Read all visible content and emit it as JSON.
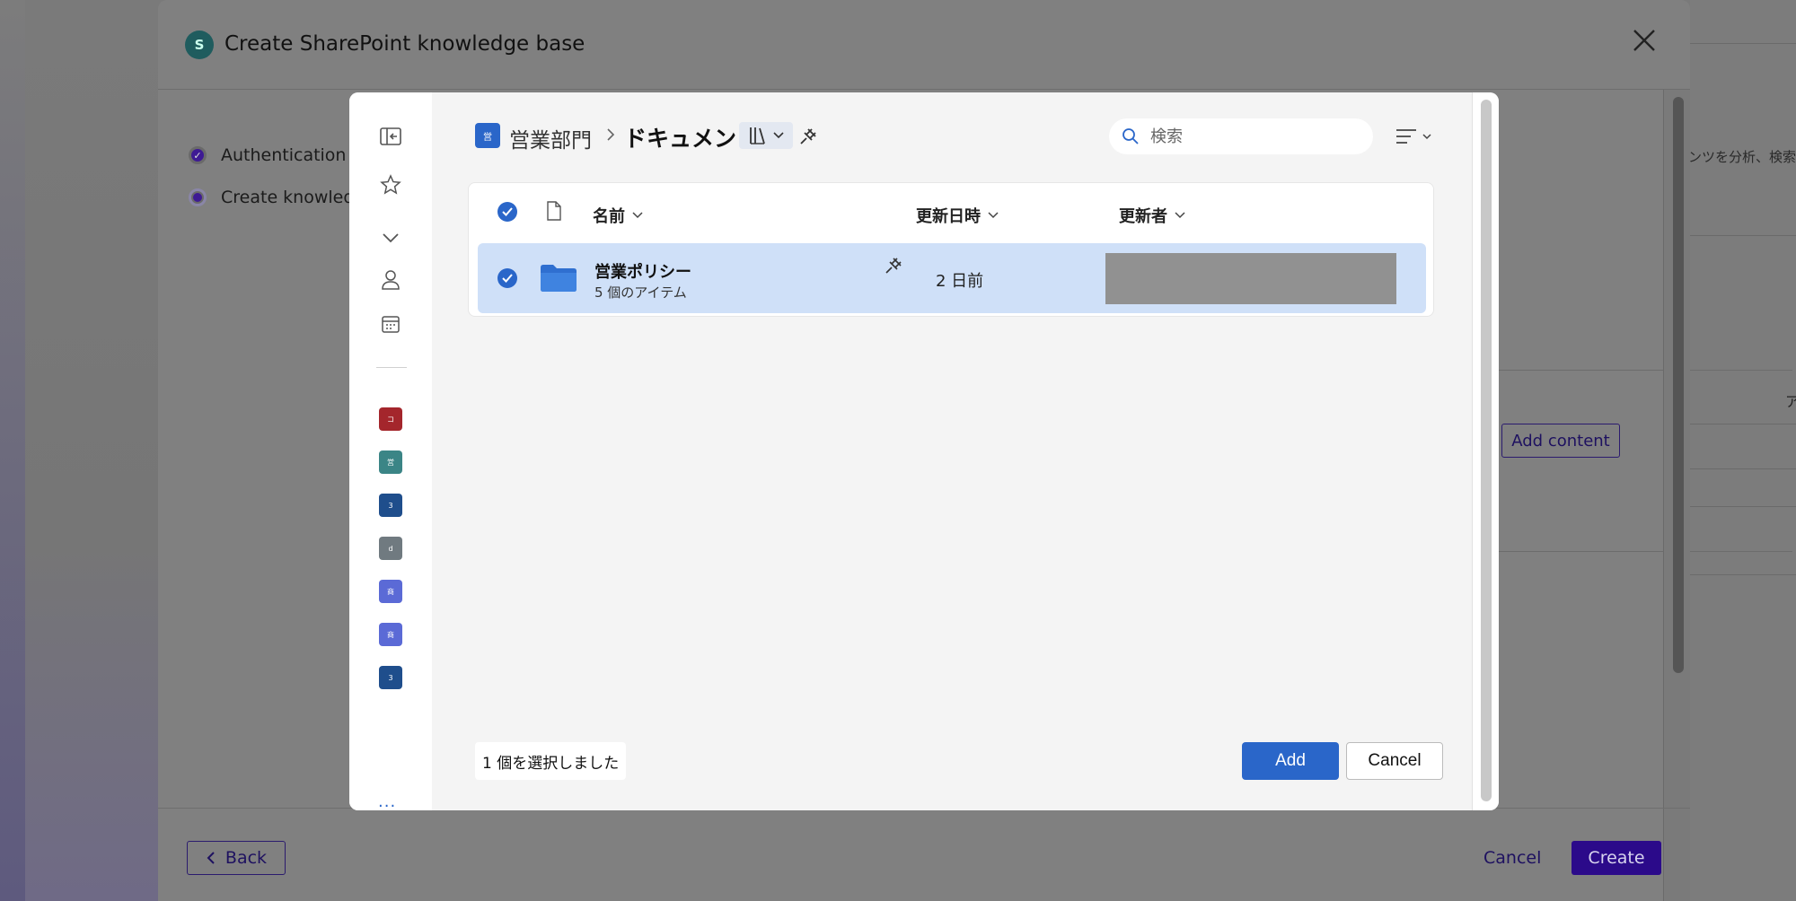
{
  "outer": {
    "title": "Create SharePoint knowledge base",
    "logo_letter": "S",
    "steps": [
      "Authentication m",
      "Create knowledge"
    ],
    "back_label": "Back",
    "cancel_label": "Cancel",
    "create_label": "Create",
    "add_content_label": "Add content",
    "right_text": "ンツを分析、検索",
    "right_col_letter": "ア"
  },
  "picker": {
    "breadcrumb": {
      "site_icon_text": "営",
      "site": "営業部門",
      "current": "ドキュメント"
    },
    "search": {
      "placeholder": "検索"
    },
    "columns": {
      "name": "名前",
      "modified": "更新日時",
      "modified_by": "更新者"
    },
    "rows": [
      {
        "name": "営業ポリシー",
        "sub": "5 個のアイテム",
        "modified": "2 日前",
        "modified_by": ""
      }
    ],
    "rail_sites": [
      {
        "letter": "コ",
        "color": "#a4262c"
      },
      {
        "letter": "営",
        "color": "#3b8586"
      },
      {
        "letter": "3",
        "color": "#1f4e8c"
      },
      {
        "letter": "d",
        "color": "#707a80"
      },
      {
        "letter": "商",
        "color": "#5b6ad6"
      },
      {
        "letter": "商",
        "color": "#5b6ad6"
      },
      {
        "letter": "3",
        "color": "#1f4e8c"
      }
    ],
    "rail_more": "...",
    "selection_text": "1 個を選択しました",
    "add_label": "Add",
    "cancel_label": "Cancel"
  },
  "colors": {
    "accent": "#2a66c9",
    "selected_row": "#cfe0f8",
    "outer_primary": "#2b0a8a"
  }
}
